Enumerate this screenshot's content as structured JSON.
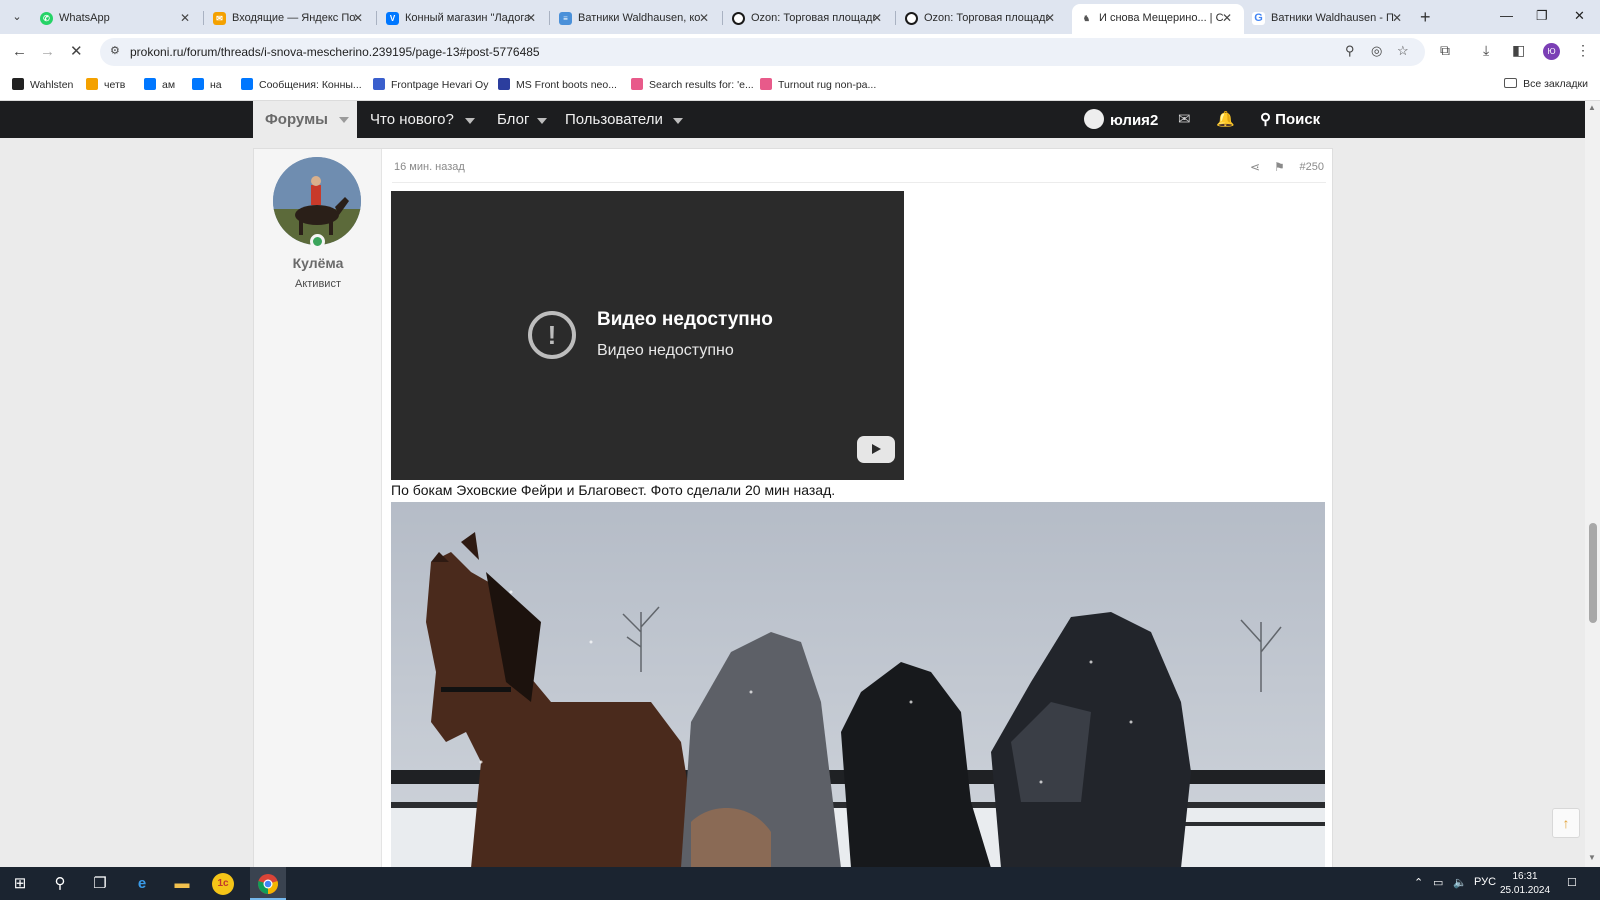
{
  "browser": {
    "tabs": [
      {
        "title": "WhatsApp",
        "icon": "whatsapp-icon",
        "color": "#25d366"
      },
      {
        "title": "Входящие — Яндекс Поч",
        "icon": "yandex-mail-icon",
        "color": "#f4a100"
      },
      {
        "title": "Конный магазин \"Ладога",
        "icon": "vk-icon",
        "color": "#0077ff"
      },
      {
        "title": "Ватники Waldhausen, ко",
        "icon": "shop-icon",
        "color": "#4a90d9"
      },
      {
        "title": "Ozon: Торговая площадк",
        "icon": "ozon-icon",
        "color": "#1a1a1a"
      },
      {
        "title": "Ozon: Торговая площадк",
        "icon": "ozon-icon",
        "color": "#1a1a1a"
      },
      {
        "title": "И снова Мещерино... | С",
        "icon": "horse-icon",
        "color": "#555555"
      },
      {
        "title": "Ватники Waldhausen - П",
        "icon": "google-icon",
        "color": "#4285f4"
      }
    ],
    "active_tab": 6,
    "url": "prokoni.ru/forum/threads/i-snova-mescherino.239195/page-13#post-5776485",
    "profile_initial": "Ю",
    "bookmarks": [
      {
        "label": "Wahlsten",
        "color": "#222222"
      },
      {
        "label": "четв",
        "color": "#f4a100"
      },
      {
        "label": "ам",
        "color": "#0077ff"
      },
      {
        "label": "на",
        "color": "#0077ff"
      },
      {
        "label": "Сообщения: Конны...",
        "color": "#0077ff"
      },
      {
        "label": "Frontpage Hevari Oy",
        "color": "#3a5fcd"
      },
      {
        "label": "MS Front boots neo...",
        "color": "#2c3e9e"
      },
      {
        "label": "Search results for: 'e...",
        "color": "#e85a8a"
      },
      {
        "label": "Turnout rug non-pa...",
        "color": "#e85a8a"
      }
    ],
    "all_bookmarks": "Все закладки"
  },
  "site_nav": {
    "forums": "Форумы",
    "whats_new": "Что нового?",
    "blog": "Блог",
    "users": "Пользователи",
    "username": "юлия2",
    "search": "Поиск"
  },
  "post": {
    "author": "Кулёма",
    "author_title": "Активист",
    "time": "16 мин. назад",
    "number": "#250",
    "video_title": "Видео недоступно",
    "video_subtitle": "Видео недоступно",
    "caption": "По бокам Эховские Фейри и Благовест. Фото сделали 20 мин назад."
  },
  "taskbar": {
    "lang": "РУС",
    "time": "16:31",
    "date": "25.01.2024"
  },
  "colors": {
    "nav_bg": "#1c1d1f",
    "accent_online": "#3ba55c",
    "scroll_top_arrow": "#e2a33a"
  }
}
